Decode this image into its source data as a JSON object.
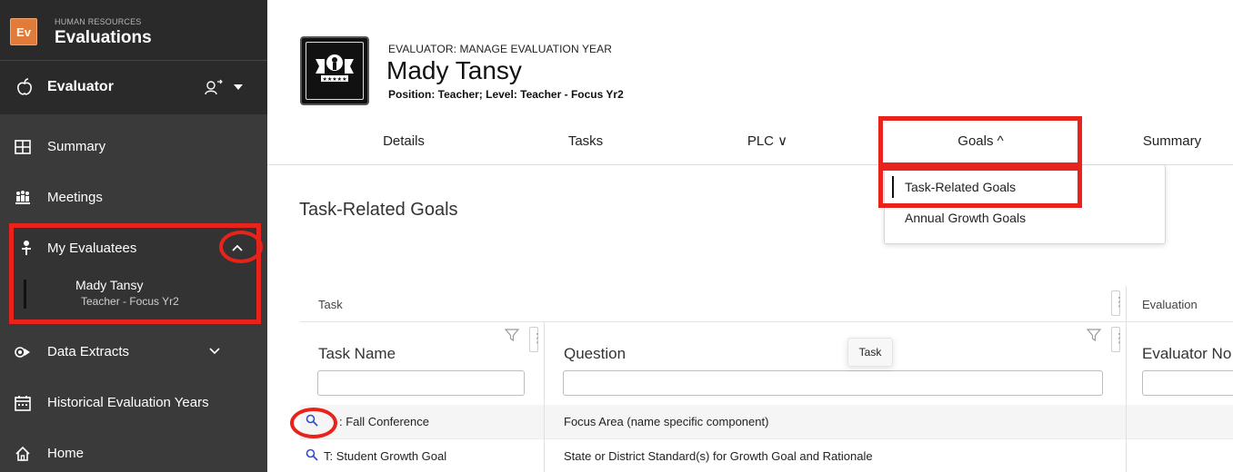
{
  "brand": {
    "badge": "Ev",
    "superscript": "HUMAN RESOURCES",
    "title": "Evaluations"
  },
  "role": {
    "label": "Evaluator"
  },
  "sidebar": {
    "items": [
      {
        "label": "Summary"
      },
      {
        "label": "Meetings"
      },
      {
        "label": "My Evaluatees"
      },
      {
        "label": "Data Extracts"
      },
      {
        "label": "Historical Evaluation Years"
      },
      {
        "label": "Home"
      }
    ],
    "evaluatee": {
      "name": "Mady Tansy",
      "role": "Teacher - Focus Yr2"
    }
  },
  "header": {
    "superscript": "EVALUATOR: MANAGE EVALUATION YEAR",
    "name": "Mady Tansy",
    "position": "Position: Teacher; Level: Teacher - Focus Yr2"
  },
  "tabs": [
    {
      "label": "Details"
    },
    {
      "label": "Tasks"
    },
    {
      "label": "PLC ∨"
    },
    {
      "label": "Goals ^"
    },
    {
      "label": "Summary"
    }
  ],
  "goals_menu": [
    {
      "label": "Task-Related Goals"
    },
    {
      "label": "Annual Growth Goals"
    }
  ],
  "section_title": "Task-Related Goals",
  "grid": {
    "group_task": "Task",
    "group_evaluation": "Evaluation",
    "col_task_name": "Task Name",
    "col_question": "Question",
    "col_evaluator_notes": "Evaluator No",
    "tooltip": "Task",
    "rows": [
      {
        "task": ": Fall Conference",
        "question": "Focus Area (name specific component)"
      },
      {
        "task": "T: Student Growth Goal",
        "question": "State or District Standard(s) for Growth Goal and Rationale"
      }
    ]
  },
  "colors": {
    "sidebar_bg": "#3a3a3a",
    "highlight": "#e8231b",
    "brand_orange": "#e07b39",
    "link_blue": "#2b4fd6"
  }
}
